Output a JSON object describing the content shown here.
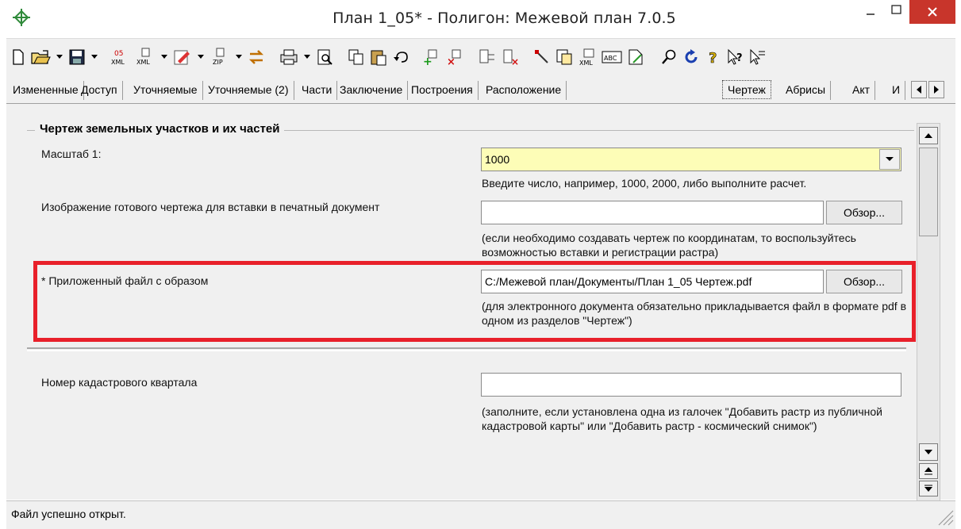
{
  "window": {
    "title": "План 1_05* - Полигон: Межевой план 7.0.5",
    "min_icon": "minimize-icon",
    "max_icon": "maximize-icon",
    "close_icon": "close-icon",
    "close_color": "#c8352b"
  },
  "toolbar": {
    "items": [
      "new-document-icon",
      "open-folder-icon",
      "save-icon",
      "export-xml-05-icon",
      "export-xml-icon",
      "sign-icon",
      "zip-icon",
      "exchange-icon",
      "print-icon",
      "preview-icon",
      "copy-icon",
      "paste-icon",
      "undo-icon",
      "add-row-icon",
      "delete-row-icon",
      "add-node-icon",
      "delete-node-icon",
      "draw-icon",
      "import-icon",
      "xml-import-icon",
      "spellcheck-icon",
      "document-icon",
      "search-icon",
      "refresh-icon",
      "help-icon",
      "context-help-icon",
      "navigate-icon"
    ]
  },
  "tabs": [
    {
      "label": "Измененные",
      "active": false
    },
    {
      "label": "Доступ",
      "active": false
    },
    {
      "label": "Уточняемые",
      "active": false
    },
    {
      "label": "Уточняемые (2)",
      "active": false
    },
    {
      "label": "Части",
      "active": false
    },
    {
      "label": "Заключение",
      "active": false
    },
    {
      "label": "Построения",
      "active": false
    },
    {
      "label": "Расположение",
      "active": false
    },
    {
      "label": "Чертеж",
      "active": true
    },
    {
      "label": "Абрисы",
      "active": false
    },
    {
      "label": "Акт",
      "active": false
    },
    {
      "label": "И",
      "active": false
    }
  ],
  "group": {
    "title": "Чертеж земельных участков и их частей"
  },
  "fields": {
    "scale": {
      "label": "Масштаб 1:",
      "value": "1000",
      "hint": "Введите число, например, 1000, 2000, либо выполните расчет."
    },
    "ready_image": {
      "label": "Изображение готового чертежа для вставки в печатный документ",
      "value": "",
      "browse": "Обзор...",
      "hint": "(если необходимо создавать чертеж по координатам, то воспользуйтесь возможностью вставки и регистрации растра)"
    },
    "attached_file": {
      "label": "* Приложенный файл с образом",
      "value": "C:/Межевой план/Документы/План 1_05 Чертеж.pdf",
      "browse": "Обзор...",
      "hint": "(для электронного документа обязательно прикладывается файл в формате pdf в одном из разделов \"Чертеж\")"
    },
    "cadastral_block": {
      "label": "Номер кадастрового квартала",
      "value": "",
      "hint": "(заполните, если установлена одна из галочек \"Добавить растр из публичной кадастровой карты\" или \"Добавить растр - космический снимок\")"
    }
  },
  "highlight_color": "#e8202a",
  "status": {
    "text": "Файл успешно открыт."
  }
}
